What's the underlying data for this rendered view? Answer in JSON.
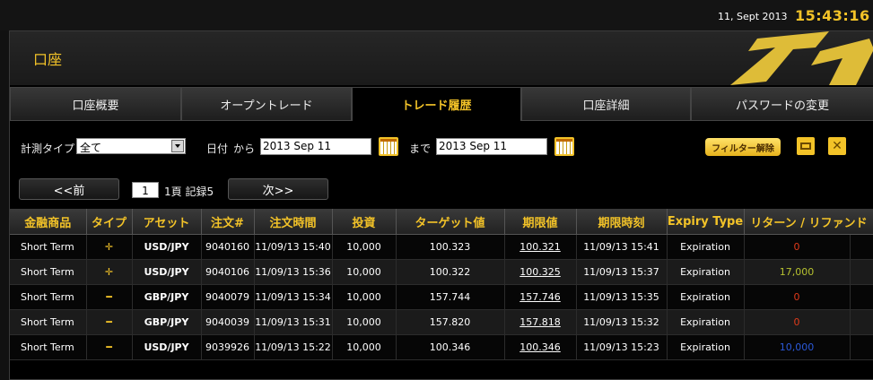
{
  "header": {
    "date": "11, Sept 2013",
    "time": "15:43:16"
  },
  "panel": {
    "title": "口座"
  },
  "tabs": [
    {
      "label": "口座概要"
    },
    {
      "label": "オープントレード"
    },
    {
      "label": "トレード履歴"
    },
    {
      "label": "口座詳細"
    },
    {
      "label": "パスワードの変更"
    }
  ],
  "filters": {
    "type_label": "計測タイプ",
    "type_value": "全て",
    "date_label": "日付",
    "from_label": "から",
    "from_value": "2013 Sep 11",
    "to_label": "まで",
    "to_value": "2013 Sep 11",
    "clear_label": "フィルター解除"
  },
  "pager": {
    "prev": "<<前",
    "page": "1",
    "info": "1頁 記録5",
    "next": "次>>"
  },
  "table": {
    "columns": [
      "金融商品",
      "タイプ",
      "アセット",
      "注文#",
      "注文時間",
      "投資",
      "ターゲット値",
      "期限値",
      "期限時刻",
      "Expiry Type",
      "リターン / リファンド"
    ],
    "rows": [
      {
        "instrument": "Short Term",
        "type": "✛",
        "asset": "USD/JPY",
        "order": "9040160",
        "time": "11/09/13 15:40",
        "invest": "10,000",
        "target": "100.323",
        "expiry_value": "100.321",
        "expiry_time": "11/09/13 15:41",
        "expiry_type": "Expiration",
        "return": "0",
        "return_color": "#e03a1a"
      },
      {
        "instrument": "Short Term",
        "type": "✛",
        "asset": "USD/JPY",
        "order": "9040106",
        "time": "11/09/13 15:36",
        "invest": "10,000",
        "target": "100.322",
        "expiry_value": "100.325",
        "expiry_time": "11/09/13 15:37",
        "expiry_type": "Expiration",
        "return": "17,000",
        "return_color": "#b7c230"
      },
      {
        "instrument": "Short Term",
        "type": "━",
        "asset": "GBP/JPY",
        "order": "9040079",
        "time": "11/09/13 15:34",
        "invest": "10,000",
        "target": "157.744",
        "expiry_value": "157.746",
        "expiry_time": "11/09/13 15:35",
        "expiry_type": "Expiration",
        "return": "0",
        "return_color": "#e03a1a"
      },
      {
        "instrument": "Short Term",
        "type": "━",
        "asset": "GBP/JPY",
        "order": "9040039",
        "time": "11/09/13 15:31",
        "invest": "10,000",
        "target": "157.820",
        "expiry_value": "157.818",
        "expiry_time": "11/09/13 15:32",
        "expiry_type": "Expiration",
        "return": "0",
        "return_color": "#e03a1a"
      },
      {
        "instrument": "Short Term",
        "type": "━",
        "asset": "USD/JPY",
        "order": "9039926",
        "time": "11/09/13 15:22",
        "invest": "10,000",
        "target": "100.346",
        "expiry_value": "100.346",
        "expiry_time": "11/09/13 15:23",
        "expiry_type": "Expiration",
        "return": "10,000",
        "return_color": "#2b59d9"
      }
    ]
  },
  "colors": {
    "accent": "#f3c328"
  }
}
